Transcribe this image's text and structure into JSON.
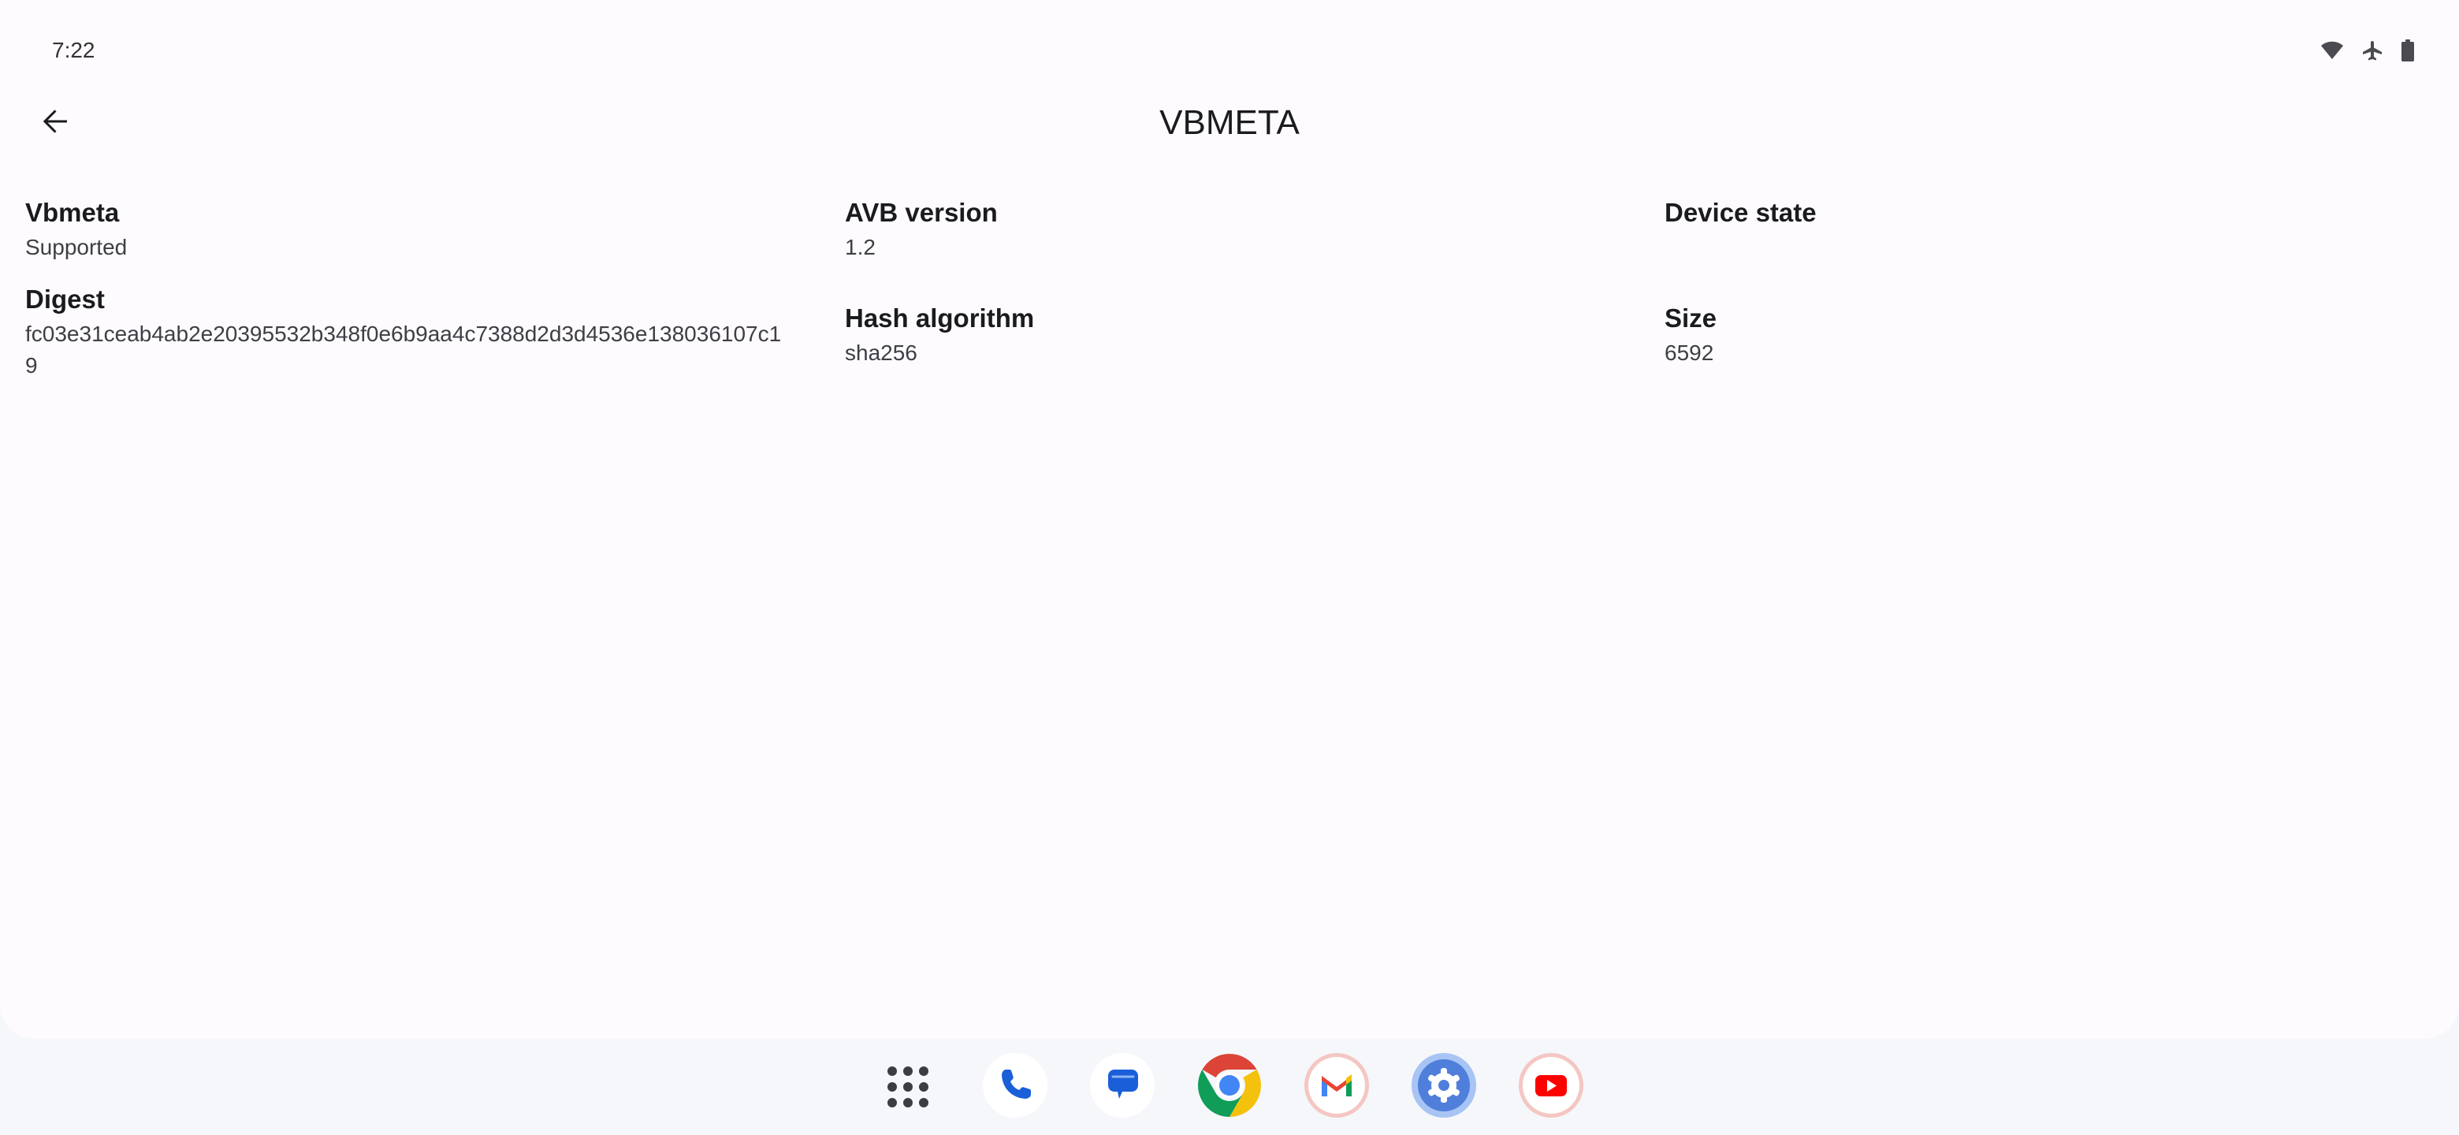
{
  "status_bar": {
    "time": "7:22",
    "icons": [
      "wifi-icon",
      "airplane-icon",
      "battery-icon"
    ]
  },
  "header": {
    "title": "VBMETA",
    "back_icon": "arrow-back-icon"
  },
  "info": {
    "vbmeta": {
      "label": "Vbmeta",
      "value": "Supported"
    },
    "digest": {
      "label": "Digest",
      "value": "fc03e31ceab4ab2e20395532b348f0e6b9aa4c7388d2d3d4536e138036107c19"
    },
    "avb_version": {
      "label": "AVB version",
      "value": "1.2"
    },
    "hash_algorithm": {
      "label": "Hash algorithm",
      "value": "sha256"
    },
    "device_state": {
      "label": "Device state",
      "value": ""
    },
    "size": {
      "label": "Size",
      "value": "6592"
    }
  },
  "dock": {
    "apps": [
      "app-drawer",
      "phone",
      "messages",
      "chrome",
      "gmail",
      "settings",
      "youtube"
    ]
  },
  "colors": {
    "background": "#fefbff",
    "dock_background": "#f6f7fb",
    "text_primary": "#1b1b1f",
    "text_secondary": "#3e3e45"
  }
}
